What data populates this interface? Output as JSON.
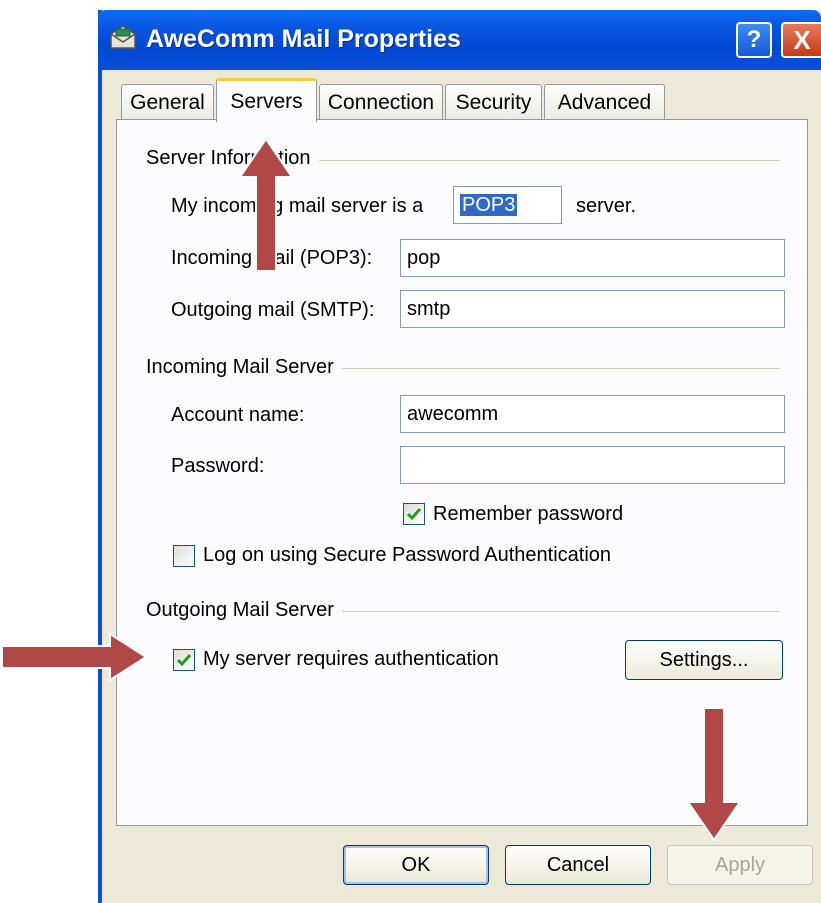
{
  "window": {
    "title": "AweComm Mail Properties",
    "help_label": "?",
    "close_label": "X"
  },
  "tabs": [
    {
      "label": "General",
      "active": false
    },
    {
      "label": "Servers",
      "active": true
    },
    {
      "label": "Connection",
      "active": false
    },
    {
      "label": "Security",
      "active": false
    },
    {
      "label": "Advanced",
      "active": false
    }
  ],
  "server_information": {
    "group_label": "Server Information",
    "server_type_prefix": "My incoming mail server is a",
    "server_type_value": "POP3",
    "server_type_suffix": "server.",
    "incoming_label": "Incoming mail (POP3):",
    "incoming_value": "pop",
    "outgoing_label": "Outgoing mail (SMTP):",
    "outgoing_value": "smtp"
  },
  "incoming_server": {
    "group_label": "Incoming Mail Server",
    "account_label": "Account name:",
    "account_value": "awecomm",
    "password_label": "Password:",
    "password_value": "",
    "remember_label": "Remember password",
    "remember_checked": true,
    "spa_label": "Log on using Secure Password Authentication",
    "spa_checked": false
  },
  "outgoing_server": {
    "group_label": "Outgoing Mail Server",
    "auth_label": "My server requires authentication",
    "auth_checked": true,
    "settings_label": "Settings..."
  },
  "buttons": {
    "ok": "OK",
    "cancel": "Cancel",
    "apply": "Apply"
  },
  "colors": {
    "title_bar": "#0a58e3",
    "annotation_arrow": "#b04848",
    "checkmark": "#21a121"
  }
}
